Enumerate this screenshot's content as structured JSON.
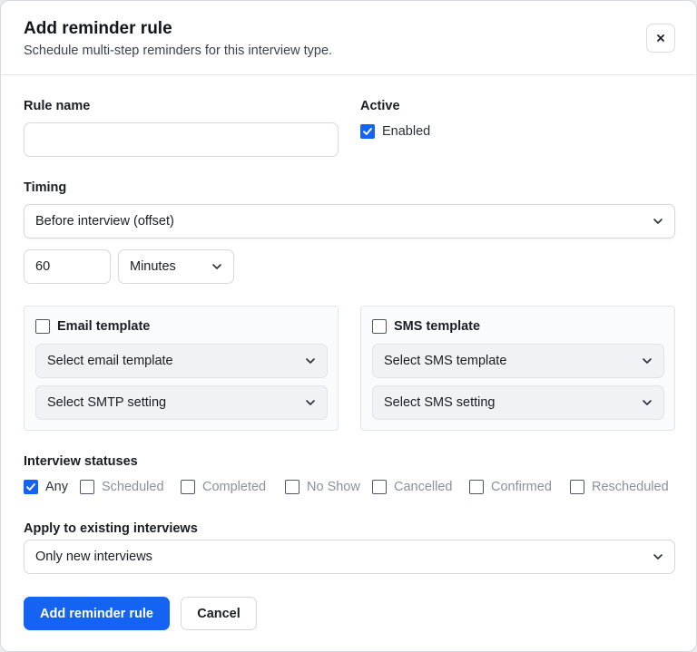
{
  "dialog": {
    "title": "Add reminder rule",
    "subtitle": "Schedule multi-step reminders for this interview type.",
    "close_icon": "close-icon"
  },
  "rule_name": {
    "label": "Rule name",
    "value": "",
    "placeholder": ""
  },
  "active": {
    "label": "Active",
    "checkbox_label": "Enabled",
    "checked": true
  },
  "timing": {
    "label": "Timing",
    "mode": "Before interview (offset)",
    "offset_value": "60",
    "offset_unit": "Minutes"
  },
  "email": {
    "title": "Email template",
    "checked": false,
    "template_select": "Select email template",
    "smtp_select": "Select SMTP setting"
  },
  "sms": {
    "title": "SMS template",
    "checked": false,
    "template_select": "Select SMS template",
    "setting_select": "Select SMS setting"
  },
  "statuses": {
    "label": "Interview statuses",
    "items": [
      {
        "label": "Any",
        "checked": true
      },
      {
        "label": "Scheduled",
        "checked": false
      },
      {
        "label": "Completed",
        "checked": false
      },
      {
        "label": "No Show",
        "checked": false
      },
      {
        "label": "Cancelled",
        "checked": false
      },
      {
        "label": "Confirmed",
        "checked": false
      },
      {
        "label": "Rescheduled",
        "checked": false
      }
    ]
  },
  "apply_existing": {
    "label": "Apply to existing interviews",
    "value": "Only new interviews"
  },
  "actions": {
    "submit": "Add reminder rule",
    "cancel": "Cancel"
  },
  "colors": {
    "primary": "#1463f3",
    "muted_text": "#8b909c"
  }
}
